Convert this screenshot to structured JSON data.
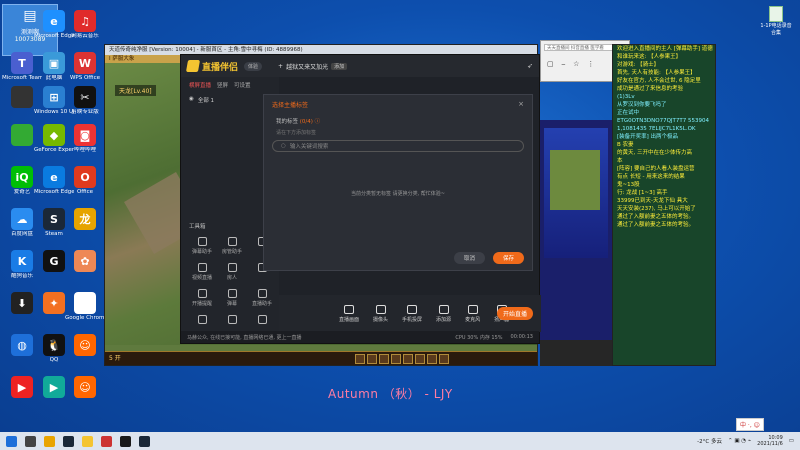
{
  "desktop": {
    "user_tile": {
      "line1": "测测啊",
      "line2": "10073089"
    },
    "icons": [
      {
        "label": "Microsoft Edge",
        "color": "#1e90ff",
        "glyph": "e"
      },
      {
        "label": "网易云音乐",
        "color": "#e02b2b",
        "glyph": "♫"
      },
      {
        "label": "Microsoft Teams",
        "color": "#4a5fd0",
        "glyph": "T"
      },
      {
        "label": "此电脑",
        "color": "#3a9ad9",
        "glyph": "▣"
      },
      {
        "label": "WPS Office",
        "color": "#d33",
        "glyph": "W"
      },
      {
        "label": "",
        "color": "#333",
        "glyph": ""
      },
      {
        "label": "Windows 10 Update",
        "color": "#2a7fd1",
        "glyph": "⊞"
      },
      {
        "label": "剪映专业版",
        "color": "#111",
        "glyph": "✂"
      },
      {
        "label": "",
        "color": "#3a3",
        "glyph": ""
      },
      {
        "label": "GeForce Experience",
        "color": "#76b900",
        "glyph": "◆"
      },
      {
        "label": "哔哩哔哩",
        "color": "#e33",
        "glyph": "◙"
      },
      {
        "label": "爱奇艺",
        "color": "#00be06",
        "glyph": "iQ"
      },
      {
        "label": "Microsoft Edge",
        "color": "#0a7be0",
        "glyph": "e"
      },
      {
        "label": "Office",
        "color": "#e03a1e",
        "glyph": "O"
      },
      {
        "label": "百度网盘",
        "color": "#2a8cf0",
        "glyph": "☁"
      },
      {
        "label": "Steam",
        "color": "#1b2838",
        "glyph": "S"
      },
      {
        "label": "",
        "color": "#e6a400",
        "glyph": "龙"
      },
      {
        "label": "酷狗音乐",
        "color": "#1a7ce6",
        "glyph": "K"
      },
      {
        "label": "",
        "color": "#111",
        "glyph": "G"
      },
      {
        "label": "",
        "color": "#e85",
        "glyph": "✿"
      },
      {
        "label": "",
        "color": "#222",
        "glyph": "⬇"
      },
      {
        "label": "",
        "color": "#f37021",
        "glyph": "✦"
      },
      {
        "label": "Google Chrome",
        "color": "#fff",
        "glyph": "◎"
      },
      {
        "label": "",
        "color": "#1e6fd9",
        "glyph": "◍"
      },
      {
        "label": "QQ",
        "color": "#111",
        "glyph": "🐧"
      },
      {
        "label": "",
        "color": "#f60",
        "glyph": "☺"
      },
      {
        "label": "",
        "color": "#e22",
        "glyph": "▶"
      },
      {
        "label": "",
        "color": "#1a9",
        "glyph": "▶"
      },
      {
        "label": "",
        "color": "#f60",
        "glyph": "☺"
      }
    ],
    "top_right_icon": "1-1P电话录音合集"
  },
  "game": {
    "title": "天道传奇纯净服 [Version: 10004] - 新服首区 - 主角:雪中寻梅 (ID: 4889968)",
    "tab": "Ⅰ 萨服大象",
    "name_tag": "天龙[Lv.40]",
    "hud_label": "5 开"
  },
  "app": {
    "logo_text": "直播伴侣",
    "version_pill": "体验",
    "tabs": [
      "横屏直播",
      "竖屏",
      "可设置"
    ],
    "active_tab": 0,
    "scene_name": "越狱又来又加光",
    "scene_tag": "添加",
    "scene_row": "全部 1",
    "tools_title": "工具箱",
    "tools": [
      "弹幕助手",
      "房管助手",
      "",
      "视频直播",
      "房人",
      "",
      "开播提醒",
      "弹幕",
      "直播助手",
      "",
      "",
      ""
    ],
    "bottom_buttons": [
      "直播画面",
      "摄像头",
      "手机投屏",
      "添加源",
      "麦克风",
      "扬声器"
    ],
    "go_live": "开始直播",
    "status_left": "马赫公众, 在线已接可能, 直播网络已通, 更上一直播",
    "status_mid": "CPU 30%  内存 15%",
    "status_right": "00:00:13"
  },
  "modal": {
    "title": "选择主播标签",
    "section_label": "我的标签",
    "section_count": "(0/4)",
    "sub": "请在下方添加标签",
    "search_placeholder": "输入关键词搜索",
    "empty_text": "当前分类暂无标签 请更换分类, 帮忙体验~",
    "cancel": "取消",
    "save": "保存"
  },
  "browser": {
    "address": "天天直播间 抖音直播 医学看"
  },
  "chat": {
    "lines": [
      {
        "t": "欢迎进入直播间的主人 [弹幕助手]  道德",
        "c": ""
      },
      {
        "t": "和谁玩来这: 【人参果王】",
        "c": ""
      },
      {
        "t": "对游戏: 【骑士】",
        "c": ""
      },
      {
        "t": "首先, 天人有技能: 【人参果王】",
        "c": ""
      },
      {
        "t": "好友在官方, 人不会过世, 6 隐足里",
        "c": ""
      },
      {
        "t": "成功是通过了来信息的考验",
        "c": ""
      },
      {
        "t": "",
        "c": ""
      },
      {
        "t": "(1)3Lv",
        "c": "c"
      },
      {
        "t": "从罗汉到你要飞吗了",
        "c": "c"
      },
      {
        "t": "正在试中",
        "c": "c"
      },
      {
        "t": "",
        "c": ""
      },
      {
        "t": "ETG0OTN3DNO77QJT7T7 553904",
        "c": "c"
      },
      {
        "t": "1,1081435 7ELIJC7L1K5L.OK",
        "c": "c"
      },
      {
        "t": "[装备开奖率] 出两个极品",
        "c": "c"
      },
      {
        "t": "",
        "c": ""
      },
      {
        "t": "B 农妻",
        "c": ""
      },
      {
        "t": "的黄天, 三开中在在少体传力高",
        "c": ""
      },
      {
        "t": "本",
        "c": ""
      },
      {
        "t": "[阵容] 要自己的人看人装盘运营",
        "c": ""
      },
      {
        "t": "",
        "c": ""
      },
      {
        "t": "",
        "c": ""
      },
      {
        "t": "有点 长短 - 用来这来的结果",
        "c": ""
      },
      {
        "t": "鬼~13股",
        "c": ""
      },
      {
        "t": "",
        "c": ""
      },
      {
        "t": "行: 龙战 [1~3] 高手",
        "c": ""
      },
      {
        "t": "33999已到天-天龙下仙 具大",
        "c": ""
      },
      {
        "t": "天天安装(237), 马上可以开始了",
        "c": ""
      },
      {
        "t": "",
        "c": ""
      },
      {
        "t": "通过了入额前妻之五体的考验。",
        "c": ""
      },
      {
        "t": "",
        "c": ""
      },
      {
        "t": "通过了入额前妻之五体的考验。",
        "c": ""
      }
    ]
  },
  "watermark": "Autumn （秋） - LJY",
  "taskbar": {
    "ime": "中 ·, ☺",
    "weather": "-2°C 多云",
    "time": "10:09",
    "date": "2021/11/6"
  }
}
